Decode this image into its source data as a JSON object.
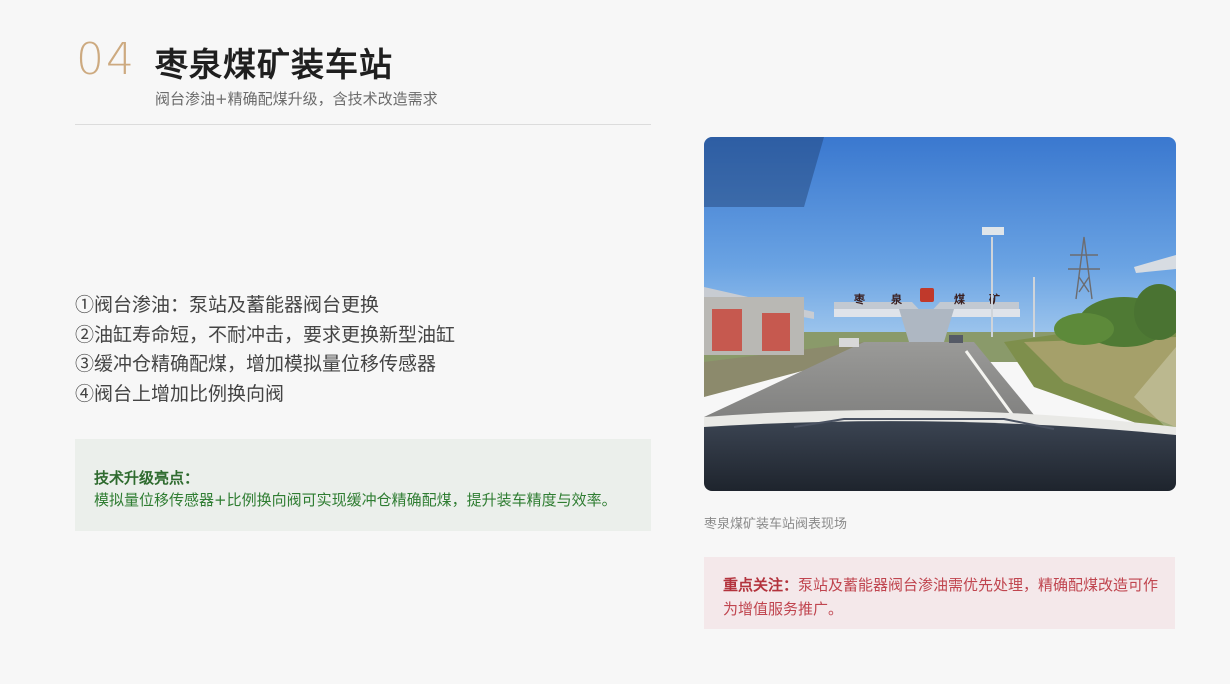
{
  "header": {
    "number": "04",
    "title": "枣泉煤矿装车站",
    "subtitle": "阀台渗油+精确配煤升级，含技术改造需求"
  },
  "issues": [
    "①阀台渗油：泵站及蓄能器阀台更换",
    "②油缸寿命短，不耐冲击，要求更换新型油缸",
    "③缓冲仓精确配煤，增加模拟量位移传感器",
    "④阀台上增加比例换向阀"
  ],
  "highlight": {
    "title": "技术升级亮点：",
    "text": "模拟量位移传感器+比例换向阀可实现缓冲仓精确配煤，提升装车精度与效率。"
  },
  "photo": {
    "sign_chars": [
      "枣",
      "泉",
      "煤",
      "矿"
    ],
    "caption": "枣泉煤矿装车站阀表现场"
  },
  "focus": {
    "label": "重点关注：",
    "text": "泵站及蓄能器阀台渗油需优先处理，精确配煤改造可作为增值服务推广。"
  },
  "colors": {
    "accent_number": "#cdaa80",
    "highlight_bg": "#ebefeb",
    "highlight_text": "#2f7d32",
    "focus_bg": "#f4e8ea",
    "focus_text": "#c0454f"
  }
}
